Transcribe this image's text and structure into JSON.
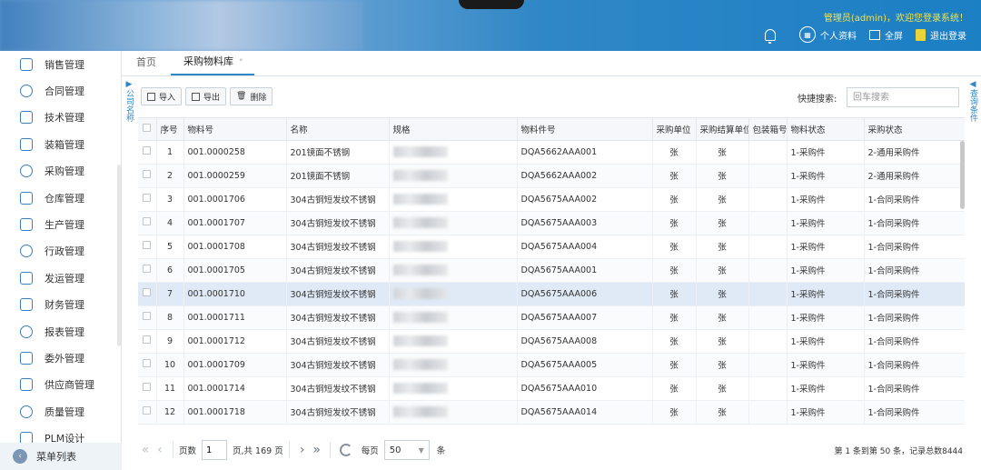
{
  "header": {
    "welcome": "管理员(admin)，欢迎您登录系统！",
    "tools": [
      {
        "icon": "apps-icon",
        "label": "个人资料"
      },
      {
        "icon": "fullscreen-icon",
        "label": "全屏"
      },
      {
        "icon": "logout-icon",
        "label": "退出登录"
      }
    ]
  },
  "sidebar": {
    "items": [
      {
        "label": "销售管理",
        "icon": "sales-icon"
      },
      {
        "label": "合同管理",
        "icon": "contract-icon"
      },
      {
        "label": "技术管理",
        "icon": "tools-icon"
      },
      {
        "label": "装箱管理",
        "icon": "box-icon"
      },
      {
        "label": "采购管理",
        "icon": "purchase-icon"
      },
      {
        "label": "仓库管理",
        "icon": "warehouse-icon"
      },
      {
        "label": "生产管理",
        "icon": "production-icon"
      },
      {
        "label": "行政管理",
        "icon": "admin-icon"
      },
      {
        "label": "发运管理",
        "icon": "shipping-icon"
      },
      {
        "label": "财务管理",
        "icon": "finance-icon"
      },
      {
        "label": "报表管理",
        "icon": "report-icon"
      },
      {
        "label": "委外管理",
        "icon": "outsource-icon"
      },
      {
        "label": "供应商管理",
        "icon": "supplier-icon"
      },
      {
        "label": "质量管理",
        "icon": "quality-icon"
      },
      {
        "label": "PLM设计",
        "icon": "plm-icon"
      }
    ],
    "footer": "菜单列表"
  },
  "tabs": {
    "home": "首页",
    "active": "采购物料库"
  },
  "side_handles": {
    "left": "公司名称",
    "right": "查询条件"
  },
  "toolbar": {
    "import": "导入",
    "export": "导出",
    "delete": "删除",
    "search_label": "快捷搜索:",
    "search_placeholder": "回车搜索"
  },
  "table": {
    "columns": [
      "序号",
      "物料号",
      "名称",
      "规格",
      "物料件号",
      "采购单位",
      "采购结算单位",
      "包装箱号",
      "物料状态",
      "采购状态"
    ],
    "rows": [
      {
        "no": "1",
        "code": "001.0000258",
        "name": "201镜面不锈钢",
        "part": "DQA5662AAA001",
        "unit": "张",
        "settle": "张",
        "box": "",
        "mstatus": "1-采购件",
        "pstatus": "2-通用采购件"
      },
      {
        "no": "2",
        "code": "001.0000259",
        "name": "201镜面不锈钢",
        "part": "DQA5662AAA002",
        "unit": "张",
        "settle": "张",
        "box": "",
        "mstatus": "1-采购件",
        "pstatus": "2-通用采购件"
      },
      {
        "no": "3",
        "code": "001.0001706",
        "name": "304古铜短发纹不锈钢",
        "part": "DQA5675AAA002",
        "unit": "张",
        "settle": "张",
        "box": "",
        "mstatus": "1-采购件",
        "pstatus": "1-合同采购件"
      },
      {
        "no": "4",
        "code": "001.0001707",
        "name": "304古铜短发纹不锈钢",
        "part": "DQA5675AAA003",
        "unit": "张",
        "settle": "张",
        "box": "",
        "mstatus": "1-采购件",
        "pstatus": "1-合同采购件"
      },
      {
        "no": "5",
        "code": "001.0001708",
        "name": "304古铜短发纹不锈钢",
        "part": "DQA5675AAA004",
        "unit": "张",
        "settle": "张",
        "box": "",
        "mstatus": "1-采购件",
        "pstatus": "1-合同采购件"
      },
      {
        "no": "6",
        "code": "001.0001705",
        "name": "304古铜短发纹不锈钢",
        "part": "DQA5675AAA001",
        "unit": "张",
        "settle": "张",
        "box": "",
        "mstatus": "1-采购件",
        "pstatus": "1-合同采购件"
      },
      {
        "no": "7",
        "code": "001.0001710",
        "name": "304古铜短发纹不锈钢",
        "part": "DQA5675AAA006",
        "unit": "张",
        "settle": "张",
        "box": "",
        "mstatus": "1-采购件",
        "pstatus": "1-合同采购件"
      },
      {
        "no": "8",
        "code": "001.0001711",
        "name": "304古铜短发纹不锈钢",
        "part": "DQA5675AAA007",
        "unit": "张",
        "settle": "张",
        "box": "",
        "mstatus": "1-采购件",
        "pstatus": "1-合同采购件"
      },
      {
        "no": "9",
        "code": "001.0001712",
        "name": "304古铜短发纹不锈钢",
        "part": "DQA5675AAA008",
        "unit": "张",
        "settle": "张",
        "box": "",
        "mstatus": "1-采购件",
        "pstatus": "1-合同采购件"
      },
      {
        "no": "10",
        "code": "001.0001709",
        "name": "304古铜短发纹不锈钢",
        "part": "DQA5675AAA005",
        "unit": "张",
        "settle": "张",
        "box": "",
        "mstatus": "1-采购件",
        "pstatus": "1-合同采购件"
      },
      {
        "no": "11",
        "code": "001.0001714",
        "name": "304古铜短发纹不锈钢",
        "part": "DQA5675AAA010",
        "unit": "张",
        "settle": "张",
        "box": "",
        "mstatus": "1-采购件",
        "pstatus": "1-合同采购件"
      },
      {
        "no": "12",
        "code": "001.0001718",
        "name": "304古铜短发纹不锈钢",
        "part": "DQA5675AAA014",
        "unit": "张",
        "settle": "张",
        "box": "",
        "mstatus": "1-采购件",
        "pstatus": "1-合同采购件"
      }
    ],
    "selected_row": 7
  },
  "pager": {
    "page_label": "页数",
    "page_value": "1",
    "total_pages": "页,共 169 页",
    "per_page_label": "每页",
    "per_page_value": "50",
    "per_page_unit": "条",
    "info": "第 1 条到第 50 条，记录总数8444"
  },
  "colors": {
    "header_blue": "#1b7fc4",
    "accent": "#2f87c6",
    "welcome_yellow": "#f2e24a",
    "selected_row": "#dfeaf6"
  }
}
